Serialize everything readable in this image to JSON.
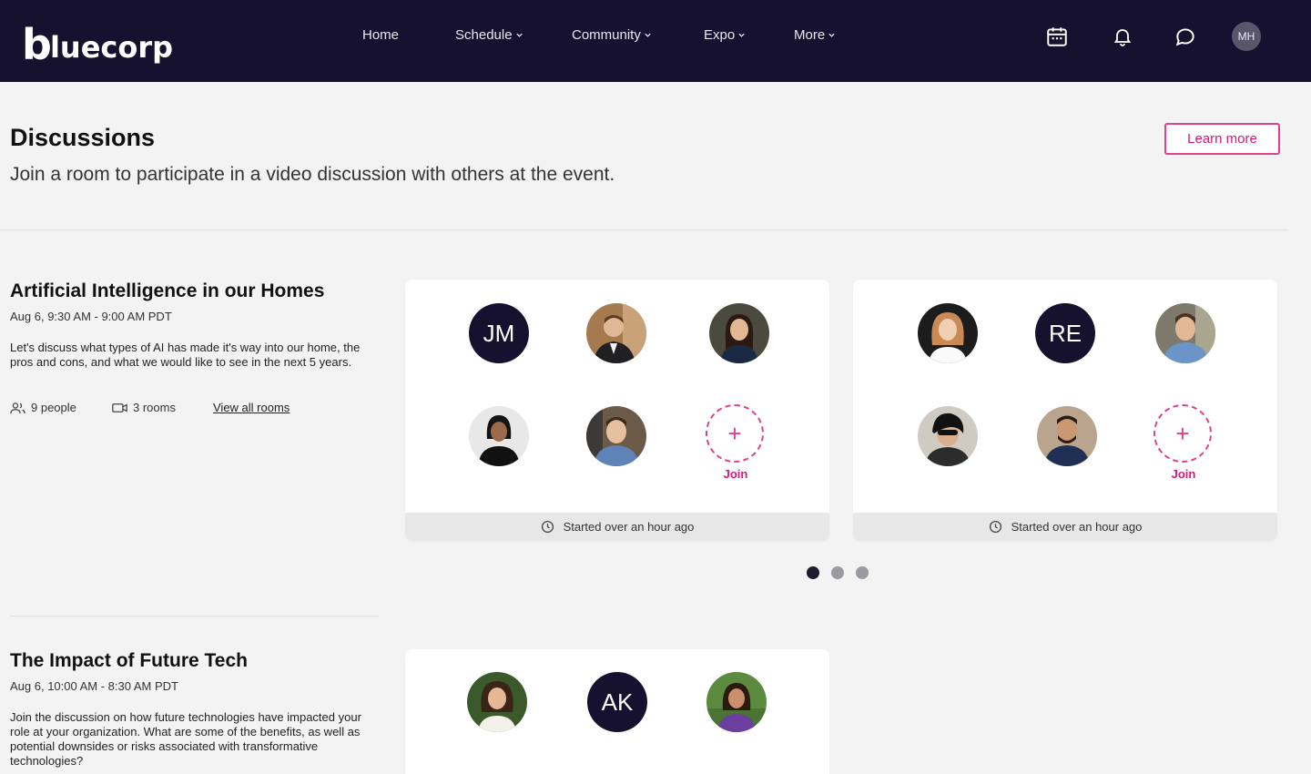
{
  "brand": {
    "logo_initial": "b",
    "logo_rest": "luecorp"
  },
  "nav": [
    {
      "label": "Home",
      "has_chevron": false
    },
    {
      "label": "Schedule",
      "has_chevron": true
    },
    {
      "label": "Community",
      "has_chevron": true
    },
    {
      "label": "Expo",
      "has_chevron": true
    },
    {
      "label": "More",
      "has_chevron": true
    }
  ],
  "top_icons": [
    "calendar-icon",
    "bell-icon",
    "chat-icon"
  ],
  "user": {
    "initials": "MH"
  },
  "header": {
    "title": "Discussions",
    "subtitle": "Join a room to participate in a video discussion with others at the event.",
    "learn_more": "Learn more"
  },
  "discussions": [
    {
      "title": "Artificial Intelligence in our Homes",
      "date": "Aug 6, 9:30 AM - 9:00 AM PDT",
      "description": "Let's discuss what types of AI has made it's way into our home, the pros and cons, and what we would like to see in the next 5 years.",
      "people": "9 people",
      "rooms": "3 rooms",
      "view_all": "View all rooms",
      "room_cards": [
        {
          "participants": [
            {
              "type": "initials",
              "text": "JM"
            },
            {
              "type": "photo",
              "name": "participant-photo-suit-man"
            },
            {
              "type": "photo",
              "name": "participant-photo-dark-hair-woman"
            },
            {
              "type": "photo",
              "name": "participant-photo-black-top-woman"
            },
            {
              "type": "photo",
              "name": "participant-photo-smiling-man"
            },
            {
              "type": "join",
              "text": "Join"
            }
          ],
          "status": "Started over an hour ago"
        },
        {
          "participants": [
            {
              "type": "photo",
              "name": "participant-photo-blonde-woman"
            },
            {
              "type": "initials",
              "text": "RE"
            },
            {
              "type": "photo",
              "name": "participant-photo-blue-shirt-man"
            },
            {
              "type": "photo",
              "name": "participant-photo-sunglasses-man"
            },
            {
              "type": "photo",
              "name": "participant-photo-bearded-man"
            },
            {
              "type": "join",
              "text": "Join"
            }
          ],
          "status": "Started over an hour ago"
        }
      ]
    },
    {
      "title": "The Impact of Future Tech",
      "date": "Aug 6, 10:00 AM - 8:30 AM PDT",
      "description": "Join the discussion on how future technologies have impacted your role at your organization. What are some of the benefits, as well as potential downsides or risks associated with transformative technologies?",
      "room_cards": [
        {
          "participants": [
            {
              "type": "photo",
              "name": "participant-photo-curly-hair-woman"
            },
            {
              "type": "initials",
              "text": "AK"
            },
            {
              "type": "photo",
              "name": "participant-photo-purple-top-woman"
            }
          ]
        }
      ]
    }
  ],
  "carousel": {
    "pages": 3,
    "active": 1
  },
  "colors": {
    "navy": "#15112e",
    "accent": "#d6197c",
    "dot_active": "#1c1c2e",
    "dot_inactive": "#9a9aa2"
  }
}
